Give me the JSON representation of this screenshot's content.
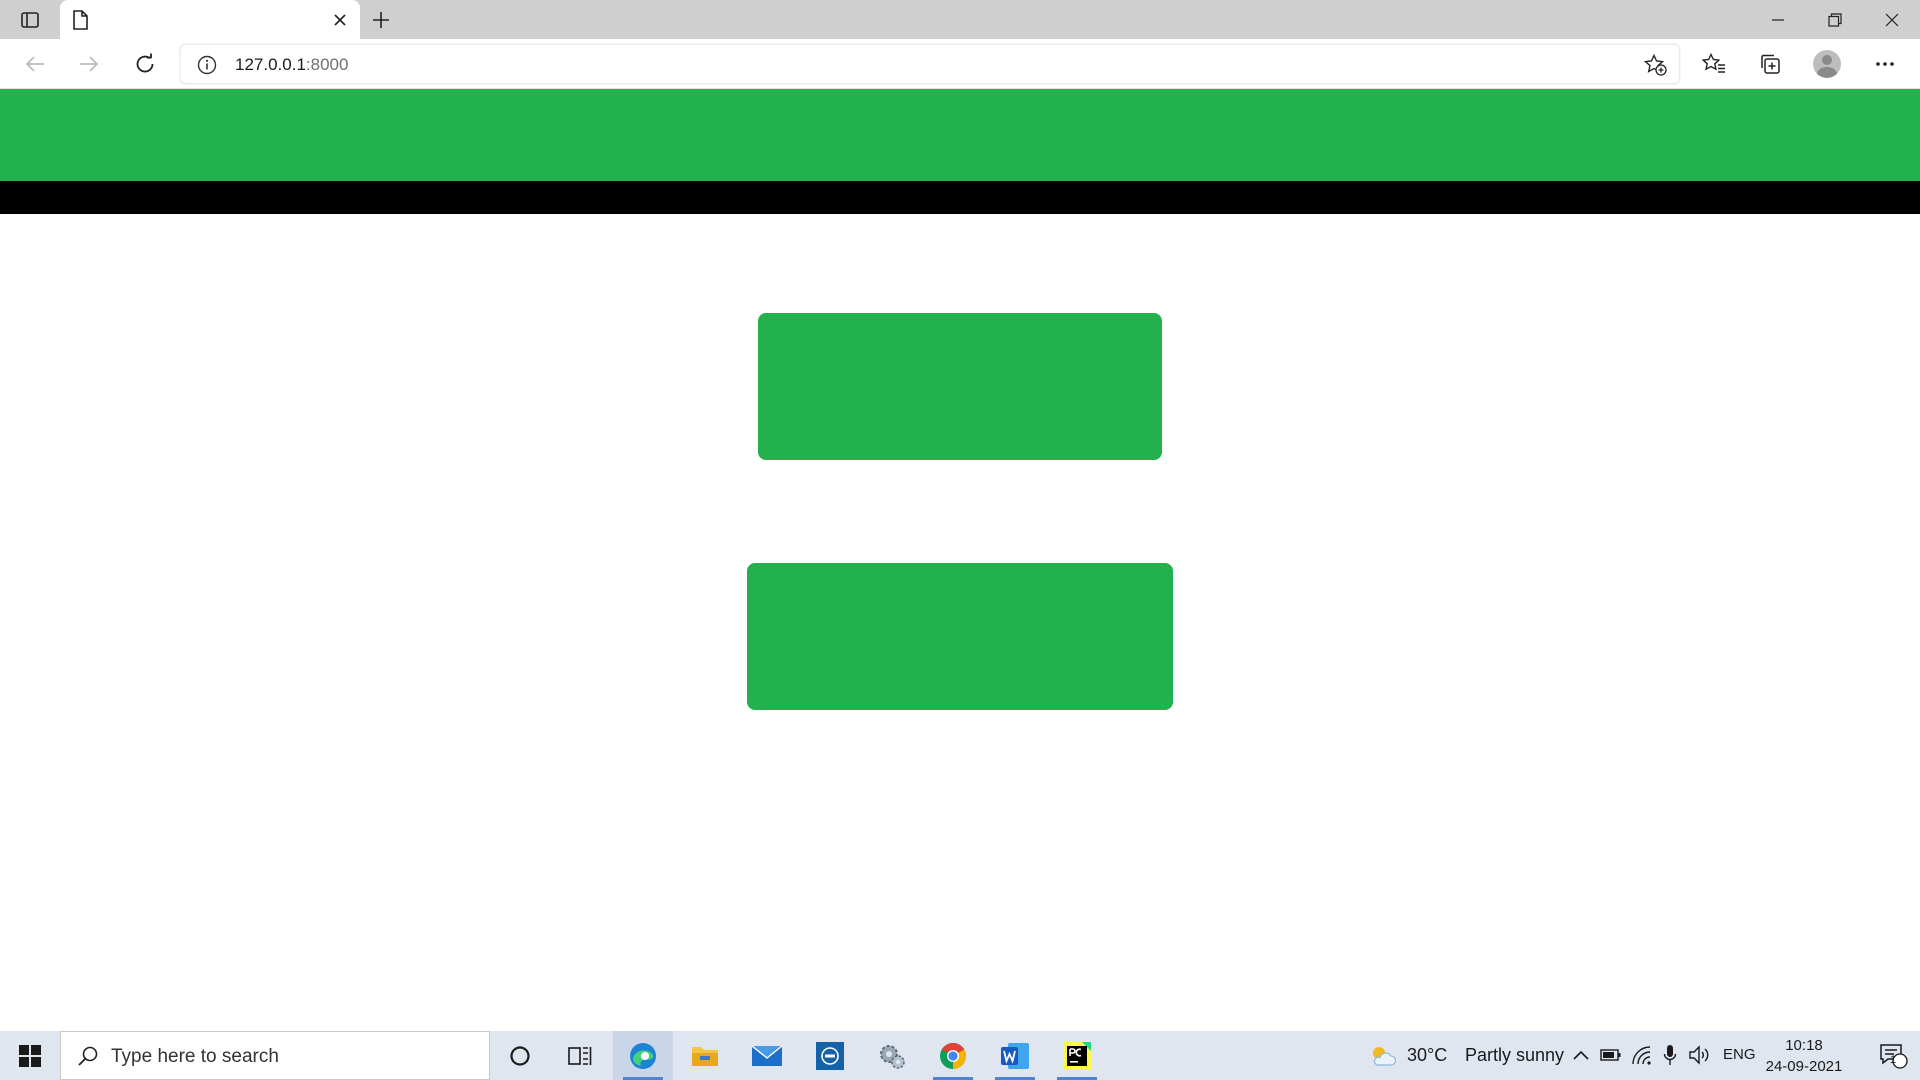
{
  "browser": {
    "address_bar": {
      "url_host": "127.0.0.1",
      "url_port": ":8000"
    },
    "window_controls": [
      "minimize",
      "restore",
      "close"
    ]
  },
  "page": {
    "colors": {
      "header": "#22b14c",
      "nav": "#000000",
      "buttons": "#22b14c",
      "background": "#ffffff"
    }
  },
  "taskbar": {
    "search_placeholder": "Type here to search",
    "weather": {
      "temperature": "30°C",
      "condition": "Partly sunny"
    },
    "language": "ENG",
    "clock": {
      "time": "10:18",
      "date": "24-09-2021"
    },
    "notification_count": "1",
    "pinned_apps": [
      "cortana",
      "task-view",
      "edge",
      "file-explorer",
      "mail",
      "dell-app",
      "settings",
      "chrome",
      "word",
      "pycharm"
    ]
  }
}
